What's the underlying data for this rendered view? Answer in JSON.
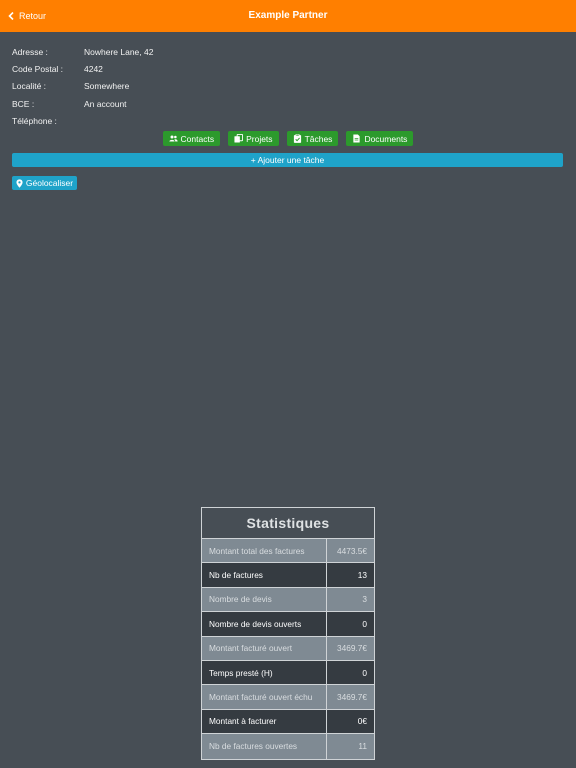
{
  "header": {
    "back_label": "Retour",
    "title": "Example Partner",
    "color": "#ff7f00"
  },
  "info": [
    {
      "label": "Adresse :",
      "value": "Nowhere Lane, 42"
    },
    {
      "label": "Code Postal :",
      "value": "4242"
    },
    {
      "label": "Localité :",
      "value": "Somewhere"
    },
    {
      "label": "BCE :",
      "value": "An account"
    },
    {
      "label": "Téléphone :",
      "value": ""
    }
  ],
  "actions": {
    "contacts": "Contacts",
    "projets": "Projets",
    "taches": "Tâches",
    "documents": "Documents",
    "add_task": "+ Ajouter une tâche",
    "geolocate": "Géolocaliser",
    "green": "#2c9a2c",
    "blue": "#1fa3c9"
  },
  "stats": {
    "title": "Statistiques",
    "rows": [
      {
        "label": "Montant total des factures",
        "value": "4473.5€"
      },
      {
        "label": "Nb de factures",
        "value": "13"
      },
      {
        "label": "Nombre de devis",
        "value": "3"
      },
      {
        "label": "Nombre de devis ouverts",
        "value": "0"
      },
      {
        "label": "Montant facturé ouvert",
        "value": "3469.7€"
      },
      {
        "label": "Temps presté (H)",
        "value": "0"
      },
      {
        "label": "Montant facturé ouvert échu",
        "value": "3469.7€"
      },
      {
        "label": "Montant à facturer",
        "value": "0€"
      },
      {
        "label": "Nb de factures ouvertes",
        "value": "11"
      }
    ]
  },
  "icons": {
    "back": "chevron-left-icon",
    "contacts": "people-icon",
    "projets": "copy-icon",
    "taches": "clipboard-icon",
    "documents": "file-icon",
    "geolocate": "map-marker-icon"
  }
}
